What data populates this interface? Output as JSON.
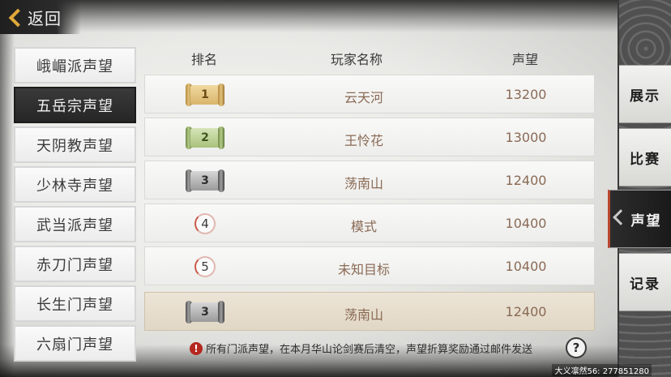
{
  "back": {
    "label": "返回"
  },
  "sects": [
    {
      "label": "峨嵋派声望",
      "active": false
    },
    {
      "label": "五岳宗声望",
      "active": true
    },
    {
      "label": "天阴教声望",
      "active": false
    },
    {
      "label": "少林寺声望",
      "active": false
    },
    {
      "label": "武当派声望",
      "active": false
    },
    {
      "label": "赤刀门声望",
      "active": false
    },
    {
      "label": "长生门声望",
      "active": false
    },
    {
      "label": "六扇门声望",
      "active": false
    }
  ],
  "table": {
    "headers": {
      "rank": "排名",
      "name": "玩家名称",
      "reputation": "声望"
    },
    "rows": [
      {
        "rank": "1",
        "badge": "gold-scroll",
        "name": "云天河",
        "reputation": "13200"
      },
      {
        "rank": "2",
        "badge": "green-scroll",
        "name": "王怜花",
        "reputation": "13000"
      },
      {
        "rank": "3",
        "badge": "silver-scroll",
        "name": "荡南山",
        "reputation": "12400"
      },
      {
        "rank": "4",
        "badge": "circle",
        "name": "模式",
        "reputation": "10400"
      },
      {
        "rank": "5",
        "badge": "circle",
        "name": "未知目标",
        "reputation": "10400"
      }
    ],
    "my_row": {
      "rank": "3",
      "badge": "silver-scroll",
      "name": "荡南山",
      "reputation": "12400"
    }
  },
  "notice": {
    "icon": "!",
    "text": "所有门派声望，在本月华山论剑赛后清空，声望折算奖励通过邮件发送"
  },
  "help": {
    "icon": "?"
  },
  "tabs": [
    {
      "label": "展示",
      "active": false
    },
    {
      "label": "比赛",
      "active": false
    },
    {
      "label": "声望",
      "active": true
    },
    {
      "label": "记录",
      "active": false
    }
  ],
  "watermark": "大义凛然56: 277851280"
}
